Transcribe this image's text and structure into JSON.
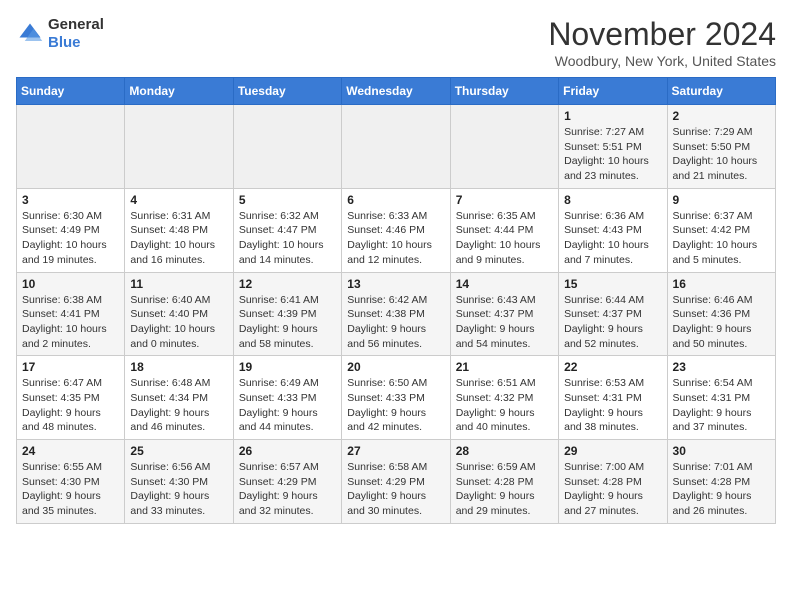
{
  "header": {
    "logo_line1": "General",
    "logo_line2": "Blue",
    "month": "November 2024",
    "location": "Woodbury, New York, United States"
  },
  "days_of_week": [
    "Sunday",
    "Monday",
    "Tuesday",
    "Wednesday",
    "Thursday",
    "Friday",
    "Saturday"
  ],
  "weeks": [
    [
      {
        "day": "",
        "info": ""
      },
      {
        "day": "",
        "info": ""
      },
      {
        "day": "",
        "info": ""
      },
      {
        "day": "",
        "info": ""
      },
      {
        "day": "",
        "info": ""
      },
      {
        "day": "1",
        "info": "Sunrise: 7:27 AM\nSunset: 5:51 PM\nDaylight: 10 hours and 23 minutes."
      },
      {
        "day": "2",
        "info": "Sunrise: 7:29 AM\nSunset: 5:50 PM\nDaylight: 10 hours and 21 minutes."
      }
    ],
    [
      {
        "day": "3",
        "info": "Sunrise: 6:30 AM\nSunset: 4:49 PM\nDaylight: 10 hours and 19 minutes."
      },
      {
        "day": "4",
        "info": "Sunrise: 6:31 AM\nSunset: 4:48 PM\nDaylight: 10 hours and 16 minutes."
      },
      {
        "day": "5",
        "info": "Sunrise: 6:32 AM\nSunset: 4:47 PM\nDaylight: 10 hours and 14 minutes."
      },
      {
        "day": "6",
        "info": "Sunrise: 6:33 AM\nSunset: 4:46 PM\nDaylight: 10 hours and 12 minutes."
      },
      {
        "day": "7",
        "info": "Sunrise: 6:35 AM\nSunset: 4:44 PM\nDaylight: 10 hours and 9 minutes."
      },
      {
        "day": "8",
        "info": "Sunrise: 6:36 AM\nSunset: 4:43 PM\nDaylight: 10 hours and 7 minutes."
      },
      {
        "day": "9",
        "info": "Sunrise: 6:37 AM\nSunset: 4:42 PM\nDaylight: 10 hours and 5 minutes."
      }
    ],
    [
      {
        "day": "10",
        "info": "Sunrise: 6:38 AM\nSunset: 4:41 PM\nDaylight: 10 hours and 2 minutes."
      },
      {
        "day": "11",
        "info": "Sunrise: 6:40 AM\nSunset: 4:40 PM\nDaylight: 10 hours and 0 minutes."
      },
      {
        "day": "12",
        "info": "Sunrise: 6:41 AM\nSunset: 4:39 PM\nDaylight: 9 hours and 58 minutes."
      },
      {
        "day": "13",
        "info": "Sunrise: 6:42 AM\nSunset: 4:38 PM\nDaylight: 9 hours and 56 minutes."
      },
      {
        "day": "14",
        "info": "Sunrise: 6:43 AM\nSunset: 4:37 PM\nDaylight: 9 hours and 54 minutes."
      },
      {
        "day": "15",
        "info": "Sunrise: 6:44 AM\nSunset: 4:37 PM\nDaylight: 9 hours and 52 minutes."
      },
      {
        "day": "16",
        "info": "Sunrise: 6:46 AM\nSunset: 4:36 PM\nDaylight: 9 hours and 50 minutes."
      }
    ],
    [
      {
        "day": "17",
        "info": "Sunrise: 6:47 AM\nSunset: 4:35 PM\nDaylight: 9 hours and 48 minutes."
      },
      {
        "day": "18",
        "info": "Sunrise: 6:48 AM\nSunset: 4:34 PM\nDaylight: 9 hours and 46 minutes."
      },
      {
        "day": "19",
        "info": "Sunrise: 6:49 AM\nSunset: 4:33 PM\nDaylight: 9 hours and 44 minutes."
      },
      {
        "day": "20",
        "info": "Sunrise: 6:50 AM\nSunset: 4:33 PM\nDaylight: 9 hours and 42 minutes."
      },
      {
        "day": "21",
        "info": "Sunrise: 6:51 AM\nSunset: 4:32 PM\nDaylight: 9 hours and 40 minutes."
      },
      {
        "day": "22",
        "info": "Sunrise: 6:53 AM\nSunset: 4:31 PM\nDaylight: 9 hours and 38 minutes."
      },
      {
        "day": "23",
        "info": "Sunrise: 6:54 AM\nSunset: 4:31 PM\nDaylight: 9 hours and 37 minutes."
      }
    ],
    [
      {
        "day": "24",
        "info": "Sunrise: 6:55 AM\nSunset: 4:30 PM\nDaylight: 9 hours and 35 minutes."
      },
      {
        "day": "25",
        "info": "Sunrise: 6:56 AM\nSunset: 4:30 PM\nDaylight: 9 hours and 33 minutes."
      },
      {
        "day": "26",
        "info": "Sunrise: 6:57 AM\nSunset: 4:29 PM\nDaylight: 9 hours and 32 minutes."
      },
      {
        "day": "27",
        "info": "Sunrise: 6:58 AM\nSunset: 4:29 PM\nDaylight: 9 hours and 30 minutes."
      },
      {
        "day": "28",
        "info": "Sunrise: 6:59 AM\nSunset: 4:28 PM\nDaylight: 9 hours and 29 minutes."
      },
      {
        "day": "29",
        "info": "Sunrise: 7:00 AM\nSunset: 4:28 PM\nDaylight: 9 hours and 27 minutes."
      },
      {
        "day": "30",
        "info": "Sunrise: 7:01 AM\nSunset: 4:28 PM\nDaylight: 9 hours and 26 minutes."
      }
    ]
  ]
}
